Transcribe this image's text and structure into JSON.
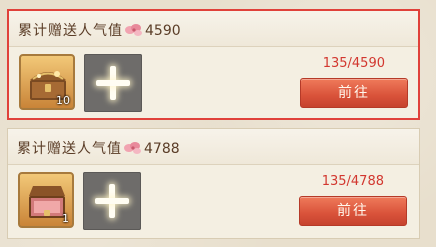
{
  "colors": {
    "selected_border": "#e0413a",
    "progress_text": "#d2372f",
    "button_fill": "#d9523a",
    "title_text": "#5a3c26"
  },
  "tasks": [
    {
      "title_prefix": "累计赠送人气值",
      "target": "4590",
      "icon": "flower-petal-icon",
      "reward_icon": "treasure-chest-icon",
      "reward_quantity": "10",
      "progress_text": "135/4590",
      "button_label": "前往",
      "selected": true
    },
    {
      "title_prefix": "累计赠送人气值",
      "target": "4788",
      "icon": "flower-petal-icon",
      "reward_icon": "treasure-chest-icon",
      "reward_quantity": "1",
      "progress_text": "135/4788",
      "button_label": "前往",
      "selected": false
    }
  ]
}
